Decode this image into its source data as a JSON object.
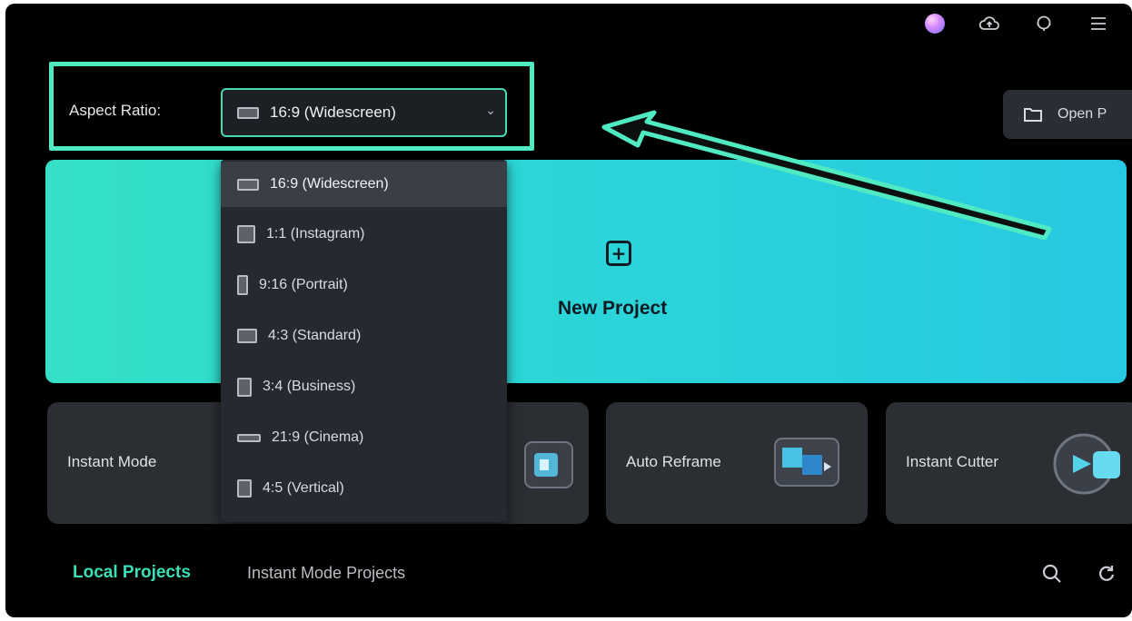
{
  "header": {
    "icons": [
      "avatar",
      "cloud-icon",
      "support-icon",
      "menu-icon"
    ]
  },
  "aspect_ratio": {
    "label": "Aspect Ratio:",
    "selected": "16:9 (Widescreen)",
    "options": [
      {
        "label": "16:9 (Widescreen)",
        "icon": "widescreen-ratio-icon"
      },
      {
        "label": "1:1 (Instagram)",
        "icon": "square-ratio-icon"
      },
      {
        "label": "9:16 (Portrait)",
        "icon": "portrait-ratio-icon"
      },
      {
        "label": "4:3 (Standard)",
        "icon": "standard-ratio-icon"
      },
      {
        "label": "3:4 (Business)",
        "icon": "business-ratio-icon"
      },
      {
        "label": "21:9 (Cinema)",
        "icon": "cinema-ratio-icon"
      },
      {
        "label": "4:5 (Vertical)",
        "icon": "vertical-ratio-icon"
      }
    ]
  },
  "open_project": {
    "label": "Open P"
  },
  "new_project": {
    "label": "New Project"
  },
  "cards": [
    {
      "label": "Instant Mode"
    },
    {
      "label": "Auto Reframe"
    },
    {
      "label": "Instant Cutter"
    }
  ],
  "tabs": {
    "local": "Local Projects",
    "instant": "Instant Mode Projects"
  },
  "colors": {
    "accent": "#39e0b7",
    "highlight": "#4fe9c2",
    "background": "#000000"
  }
}
